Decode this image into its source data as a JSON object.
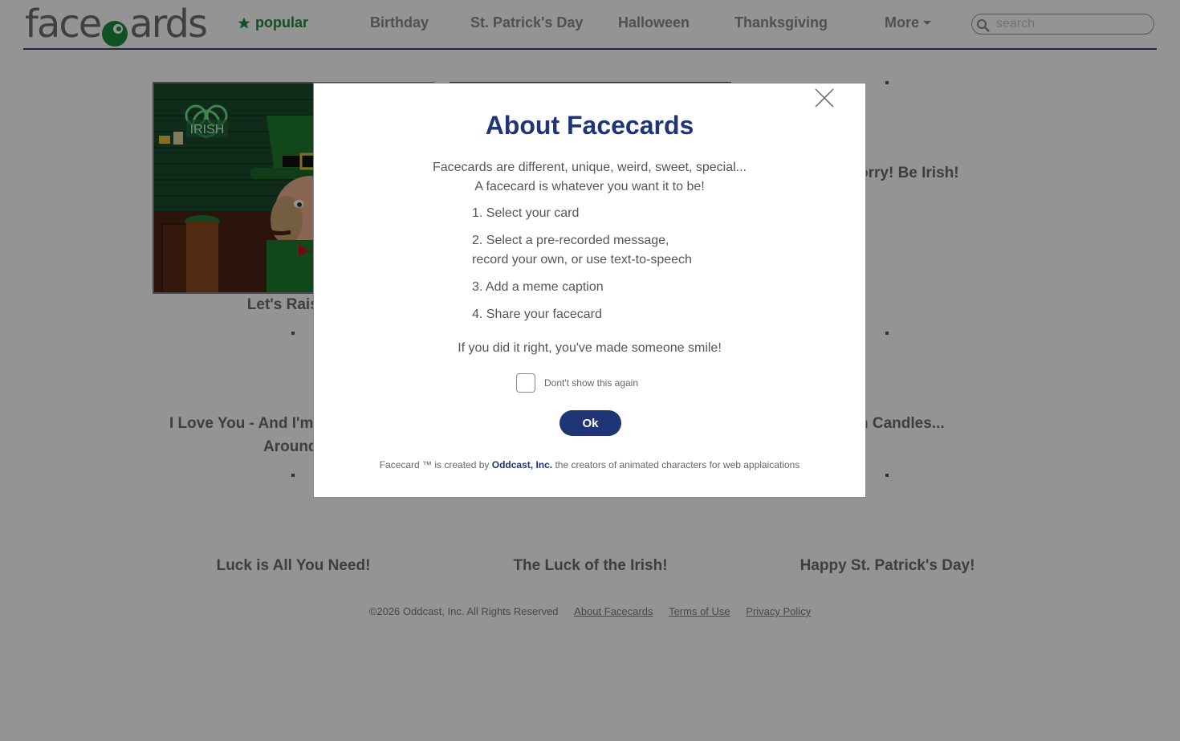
{
  "header": {
    "logo_text": "facecards",
    "nav": [
      {
        "label": "popular",
        "icon": "star-icon",
        "active": true
      },
      {
        "label": "Birthday"
      },
      {
        "label": "St. Patrick's Day"
      },
      {
        "label": "Halloween"
      },
      {
        "label": "Thanksgiving"
      },
      {
        "label": "More",
        "icon": "caret-down-icon"
      }
    ],
    "search": {
      "placeholder": "search",
      "value": ""
    }
  },
  "cards": [
    {
      "title": "Let's Raise a"
    },
    {
      "title": "orry! Be Irish!"
    },
    {
      "title": "I Love You - And I'm",
      "title2": "Around"
    },
    {
      "title": "n Candles..."
    },
    {
      "title": "Luck is All You Need!"
    },
    {
      "title": "The Luck of the Irish!"
    },
    {
      "title": "Happy St. Patrick's Day!"
    }
  ],
  "card_image": {
    "sign_text": "IRISH"
  },
  "footer": {
    "copyright": "©2026 Oddcast, Inc. All Rights Reserved",
    "links": [
      "About Facecards",
      "Terms of Use",
      "Privacy Policy"
    ]
  },
  "modal": {
    "title": "About Facecards",
    "intro_line1": "Facecards are different, unique, weird, sweet, special...",
    "intro_line2": "A facecard is whatever you want it to be!",
    "steps": [
      "1. Select your card",
      "2. Select a pre-recorded message,",
      "record your own, or use text-to-speech",
      "3. Add a meme caption",
      "4. Share your facecard"
    ],
    "smile_text": "If you did it right, you've made someone smile!",
    "checkbox_label": "Dont't show this again",
    "checkbox_checked": false,
    "ok_label": "Ok",
    "credit_prefix": "Facecard ™ is created by",
    "credit_company": "Oddcast, Inc.",
    "credit_suffix": "the creators of animated characters for web applaications"
  },
  "colors": {
    "brand_green": "#1c8a3c",
    "brand_navy": "#1f3576",
    "nav_gray": "#8a8a8a"
  }
}
